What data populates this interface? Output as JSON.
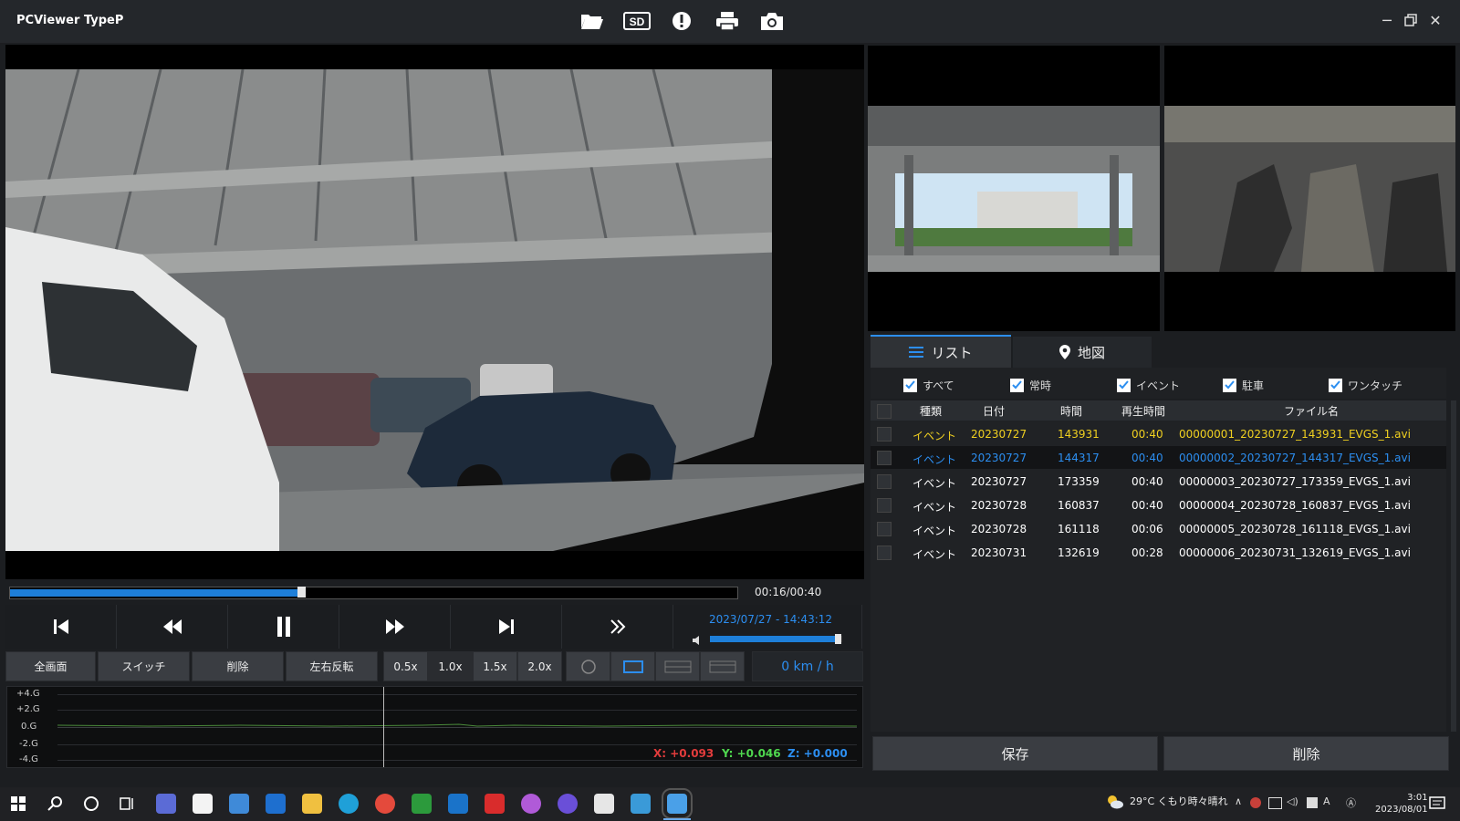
{
  "app": {
    "title": "PCViewer TypeP"
  },
  "toolbar": {
    "icons": [
      "folder-open-icon",
      "sd-card-icon",
      "alert-icon",
      "print-icon",
      "camera-icon"
    ],
    "sd_label": "SD"
  },
  "playback": {
    "progress_fraction": 0.4,
    "time": "00:16/00:40",
    "datetime": "2023/07/27 - 14:43:12",
    "volume_fraction": 0.97,
    "speed": "0 km / h"
  },
  "function_buttons": {
    "fullscreen": "全画面",
    "switch": "スイッチ",
    "delete": "削除",
    "mirror": "左右反転",
    "speeds": [
      "0.5x",
      "1.0x",
      "1.5x",
      "2.0x"
    ],
    "active_speed_index": 1
  },
  "graph": {
    "labels": [
      "+4.G",
      "+2.G",
      "0.G",
      "-2.G",
      "-4.G"
    ],
    "x_readout": "X: +0.093",
    "y_readout": "Y: +0.046",
    "z_readout": "Z: +0.000",
    "colors": {
      "x": "#e23c3c",
      "y": "#4fd84f",
      "z": "#2c8ef0"
    }
  },
  "tabs": {
    "list": "リスト",
    "map": "地図"
  },
  "filters": [
    "すべて",
    "常時",
    "イベント",
    "駐車",
    "ワンタッチ"
  ],
  "table": {
    "headers": [
      "種類",
      "日付",
      "時間",
      "再生時間",
      "ファイル名"
    ],
    "rows": [
      {
        "type": "イベント",
        "date": "20230727",
        "time": "143931",
        "duration": "00:40",
        "file": "00000001_20230727_143931_EVGS_1.avi",
        "color": "#f0d020"
      },
      {
        "type": "イベント",
        "date": "20230727",
        "time": "144317",
        "duration": "00:40",
        "file": "00000002_20230727_144317_EVGS_1.avi",
        "color": "#2c8ef0"
      },
      {
        "type": "イベント",
        "date": "20230727",
        "time": "173359",
        "duration": "00:40",
        "file": "00000003_20230727_173359_EVGS_1.avi",
        "color": "#ffffff"
      },
      {
        "type": "イベント",
        "date": "20230728",
        "time": "160837",
        "duration": "00:40",
        "file": "00000004_20230728_160837_EVGS_1.avi",
        "color": "#ffffff"
      },
      {
        "type": "イベント",
        "date": "20230728",
        "time": "161118",
        "duration": "00:06",
        "file": "00000005_20230728_161118_EVGS_1.avi",
        "color": "#ffffff"
      },
      {
        "type": "イベント",
        "date": "20230731",
        "time": "132619",
        "duration": "00:28",
        "file": "00000006_20230731_132619_EVGS_1.avi",
        "color": "#ffffff"
      }
    ]
  },
  "actions": {
    "save": "保存",
    "delete": "削除"
  },
  "taskbar": {
    "weather": "29°C くもり時々晴れ",
    "time": "3:01",
    "date": "2023/08/01"
  }
}
